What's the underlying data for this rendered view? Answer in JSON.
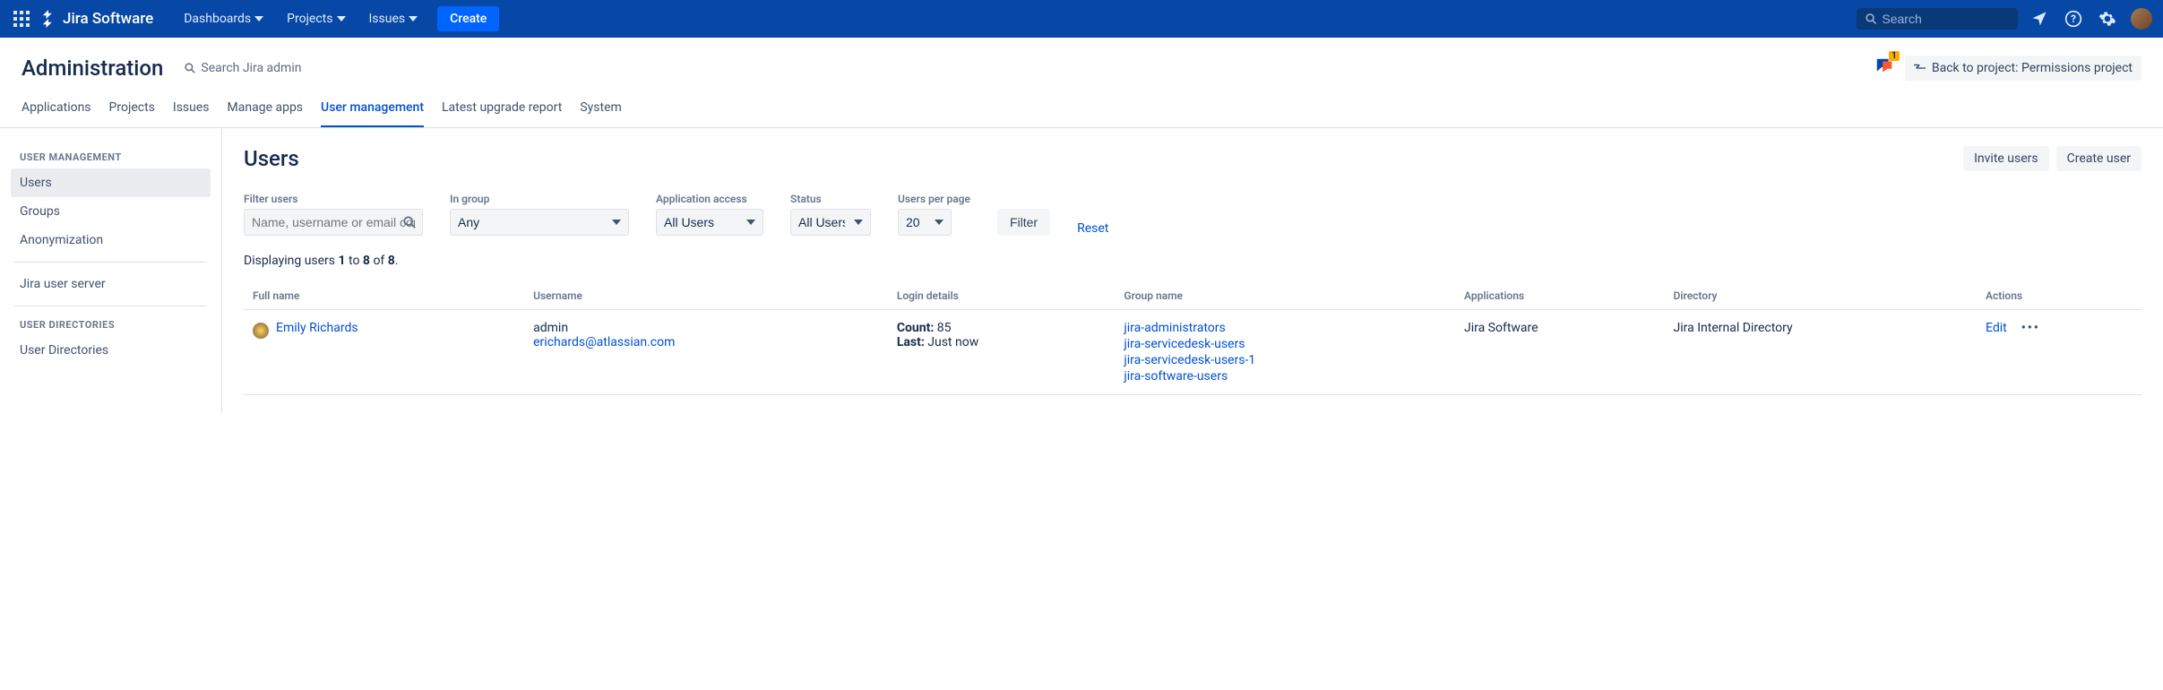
{
  "topnav": {
    "product": "Jira Software",
    "items": [
      "Dashboards",
      "Projects",
      "Issues"
    ],
    "create": "Create",
    "search_placeholder": "Search"
  },
  "admin_header": {
    "title": "Administration",
    "search_placeholder": "Search Jira admin",
    "feedback_count": "1",
    "back_label": "Back to project: Permissions project"
  },
  "admin_tabs": [
    "Applications",
    "Projects",
    "Issues",
    "Manage apps",
    "User management",
    "Latest upgrade report",
    "System"
  ],
  "active_tab": "User management",
  "sidebar": {
    "group1_title": "USER MANAGEMENT",
    "group1_items": [
      "Users",
      "Groups",
      "Anonymization"
    ],
    "group1_active": "Users",
    "extra_item": "Jira user server",
    "group2_title": "USER DIRECTORIES",
    "group2_items": [
      "User Directories"
    ]
  },
  "page": {
    "title": "Users",
    "invite_btn": "Invite users",
    "create_btn": "Create user"
  },
  "filters": {
    "filter_users_label": "Filter users",
    "filter_users_placeholder": "Name, username or email contains",
    "in_group_label": "In group",
    "in_group_value": "Any",
    "app_access_label": "Application access",
    "app_access_value": "All Users",
    "status_label": "Status",
    "status_value": "All Users",
    "per_page_label": "Users per page",
    "per_page_value": "20",
    "filter_btn": "Filter",
    "reset": "Reset"
  },
  "displaying": {
    "prefix": "Displaying users ",
    "from": "1",
    "mid1": " to ",
    "to": "8",
    "mid2": " of ",
    "total": "8",
    "suffix": "."
  },
  "table": {
    "headers": [
      "Full name",
      "Username",
      "Login details",
      "Group name",
      "Applications",
      "Directory",
      "Actions"
    ],
    "row": {
      "fullname": "Emily Richards",
      "username": "admin",
      "email": "erichards@atlassian.com",
      "login_count_label": "Count:",
      "login_count": "85",
      "login_last_label": "Last:",
      "login_last": "Just now",
      "groups": [
        "jira-administrators",
        "jira-servicedesk-users",
        "jira-servicedesk-users-1",
        "jira-software-users"
      ],
      "applications": "Jira Software",
      "directory": "Jira Internal Directory",
      "edit": "Edit"
    }
  }
}
